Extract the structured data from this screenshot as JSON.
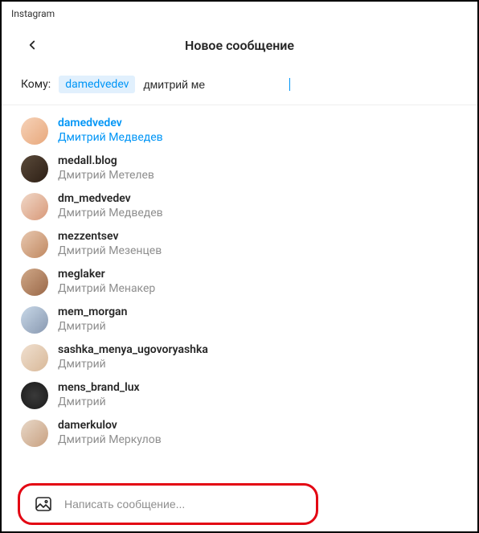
{
  "window": {
    "title": "Instagram"
  },
  "header": {
    "title": "Новое сообщение"
  },
  "compose_to": {
    "label": "Кому:",
    "chip": "damedvedev",
    "input_value": "дмитрий ме"
  },
  "suggestions": [
    {
      "username": "damedvedev",
      "fullname": "Дмитрий Медведев",
      "selected": true
    },
    {
      "username": "medall.blog",
      "fullname": "Дмитрий Метелев",
      "selected": false
    },
    {
      "username": "dm_medvedev",
      "fullname": "Дмитрий Медведев",
      "selected": false
    },
    {
      "username": "mezzentsev",
      "fullname": "Дмитрий Мезенцев",
      "selected": false
    },
    {
      "username": "meglaker",
      "fullname": "Дмитрий Менакер",
      "selected": false
    },
    {
      "username": "mem_morgan",
      "fullname": "Дмитрий",
      "selected": false
    },
    {
      "username": "sashka_menya_ugovoryashka",
      "fullname": "Дмитрий",
      "selected": false
    },
    {
      "username": "mens_brand_lux",
      "fullname": "Дмитрий",
      "selected": false
    },
    {
      "username": "damerkulov",
      "fullname": "Дмитрий Меркулов",
      "selected": false
    }
  ],
  "composer": {
    "placeholder": "Написать сообщение..."
  },
  "colors": {
    "accent": "#0095f6",
    "highlight": "#e30613"
  }
}
